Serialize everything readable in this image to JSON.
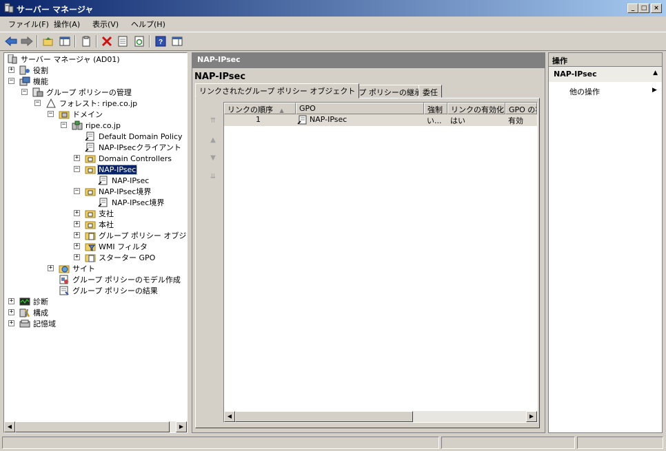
{
  "window": {
    "title": "サーバー マネージャ"
  },
  "menu": [
    "ファイル(F)",
    "操作(A)",
    "表示(V)",
    "ヘルプ(H)"
  ],
  "tree": {
    "root": "サーバー マネージャ (AD01)",
    "roles": "役割",
    "features": "機能",
    "gpm": "グループ ポリシーの管理",
    "forest": "フォレスト: ripe.co.jp",
    "domains": "ドメイン",
    "domain": "ripe.co.jp",
    "default_policy": "Default Domain Policy",
    "nap_client": "NAP-IPsecクライアント",
    "domain_controllers": "Domain Controllers",
    "nap_ipsec_ou": "NAP-IPsec",
    "nap_ipsec_gpo": "NAP-IPsec",
    "nap_boundary_ou": "NAP-IPsec境界",
    "nap_boundary_gpo": "NAP-IPsec境界",
    "branch": "支社",
    "hq": "本社",
    "gpo_objects": "グループ ポリシー オブジェクト",
    "wmi": "WMI フィルタ",
    "starter": "スターター GPO",
    "sites": "サイト",
    "modeling": "グループ ポリシーのモデル作成",
    "results": "グループ ポリシーの結果",
    "diagnostics": "診断",
    "configuration": "構成",
    "storage": "記憶域"
  },
  "center": {
    "header": "NAP-IPsec",
    "object_title": "NAP-IPsec",
    "tabs": [
      "リンクされたグループ ポリシー オブジェクト",
      "グループ ポリシーの継承",
      "委任"
    ],
    "columns": [
      "リンクの順序",
      "GPO",
      "強制",
      "リンクの有効化",
      "GPO の状態"
    ],
    "rows": [
      {
        "order": "1",
        "gpo": "NAP-IPsec",
        "enforced": "い...",
        "link_enabled": "はい",
        "gpo_status": "有効"
      }
    ]
  },
  "actions": {
    "header": "操作",
    "section": "NAP-IPsec",
    "more": "他の操作"
  },
  "colors": {
    "titlebar": "#0a246a",
    "selection": "#0a246a",
    "chrome": "#d4d0c8",
    "pane_header": "#808080"
  }
}
